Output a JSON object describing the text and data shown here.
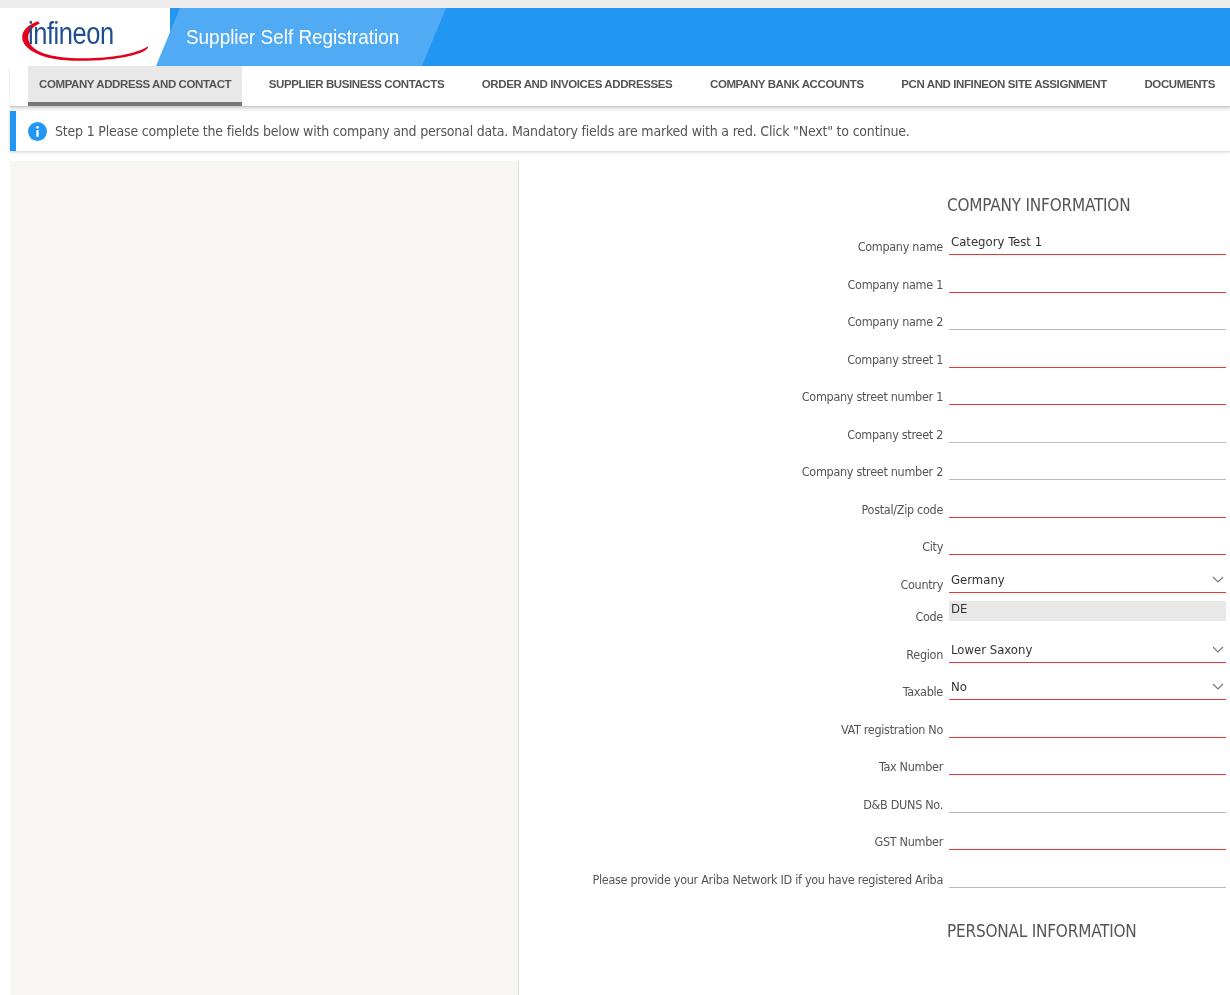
{
  "header": {
    "logo_text": "infineon",
    "title": "Supplier Self Registration"
  },
  "tabs": [
    {
      "label": "COMPANY ADDRESS AND CONTACT",
      "selected": true
    },
    {
      "label": "SUPPLIER BUSINESS CONTACTS",
      "selected": false
    },
    {
      "label": "ORDER AND INVOICES ADDRESSES",
      "selected": false
    },
    {
      "label": "COMPANY BANK ACCOUNTS",
      "selected": false
    },
    {
      "label": "PCN AND INFINEON SITE ASSIGNMENT",
      "selected": false
    },
    {
      "label": "DOCUMENTS",
      "selected": false
    }
  ],
  "info": {
    "text": "Step 1 Please complete the fields below with company and personal data. Mandatory fields are marked with a red. Click \"Next\" to continue."
  },
  "form": {
    "sections": [
      {
        "title": "COMPANY INFORMATION",
        "fields": [
          {
            "label": "Company name",
            "kind": "text",
            "value": "Category Test 1",
            "mandatory": true
          },
          {
            "label": "Company name 1",
            "kind": "text",
            "mandatory": true
          },
          {
            "label": "Company name 2",
            "kind": "text",
            "mandatory": false
          },
          {
            "label": "Company street 1",
            "kind": "text",
            "mandatory": true
          },
          {
            "label": "Company street number 1",
            "kind": "text",
            "mandatory": true
          },
          {
            "label": "Company street 2",
            "kind": "text",
            "mandatory": false
          },
          {
            "label": "Company street number 2",
            "kind": "text",
            "mandatory": false
          },
          {
            "label": "Postal/Zip code",
            "kind": "text",
            "mandatory": true
          },
          {
            "label": "City",
            "kind": "text",
            "mandatory": true
          },
          {
            "label": "Country",
            "kind": "select",
            "value": "Germany",
            "mandatory": true
          },
          {
            "label": "Code",
            "kind": "readonly",
            "value": "DE"
          },
          {
            "label": "Region",
            "kind": "select",
            "value": "Lower Saxony",
            "mandatory": true
          },
          {
            "label": "Taxable",
            "kind": "select",
            "value": "No",
            "mandatory": true
          },
          {
            "label": "VAT registration No",
            "kind": "text",
            "mandatory": true
          },
          {
            "label": "Tax Number",
            "kind": "text",
            "mandatory": true
          },
          {
            "label": "D&B DUNS No.",
            "kind": "text",
            "mandatory": false
          },
          {
            "label": "GST Number",
            "kind": "text",
            "mandatory": true
          },
          {
            "label": "Please provide your Ariba Network ID if you have registered Ariba",
            "kind": "text",
            "mandatory": false
          }
        ]
      },
      {
        "title": "PERSONAL INFORMATION"
      }
    ]
  }
}
